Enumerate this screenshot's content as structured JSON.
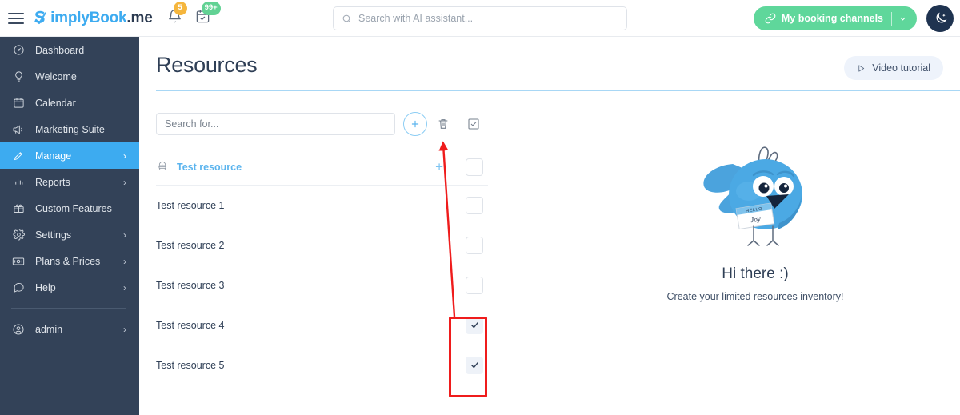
{
  "topbar": {
    "menu_icon": "hamburger-icon",
    "brand_part1": "S",
    "brand_part1b": "implyBook",
    "brand_part2": ".me",
    "notifications_badge": "5",
    "bookings_badge": "99+",
    "search_placeholder": "Search with AI assistant...",
    "search_value": "",
    "booking_channels_label": "My booking channels",
    "dark_mode_icon": "moon-icon"
  },
  "sidebar": {
    "items": [
      {
        "label": "Dashboard",
        "icon": "gauge-icon",
        "active": false,
        "chevron": false
      },
      {
        "label": "Welcome",
        "icon": "bulb-icon",
        "active": false,
        "chevron": false
      },
      {
        "label": "Calendar",
        "icon": "calendar-icon",
        "active": false,
        "chevron": false
      },
      {
        "label": "Marketing Suite",
        "icon": "megaphone-icon",
        "active": false,
        "chevron": false
      },
      {
        "label": "Manage",
        "icon": "pencil-icon",
        "active": true,
        "chevron": true
      },
      {
        "label": "Reports",
        "icon": "bar-chart-icon",
        "active": false,
        "chevron": true
      },
      {
        "label": "Custom Features",
        "icon": "gift-icon",
        "active": false,
        "chevron": false
      },
      {
        "label": "Settings",
        "icon": "gear-icon",
        "active": false,
        "chevron": true
      },
      {
        "label": "Plans & Prices",
        "icon": "money-icon",
        "active": false,
        "chevron": true
      },
      {
        "label": "Help",
        "icon": "chat-icon",
        "active": false,
        "chevron": true
      }
    ],
    "account": {
      "label": "admin",
      "icon": "user-circle-icon",
      "chevron": true
    }
  },
  "main": {
    "page_title": "Resources",
    "video_tutorial_label": "Video tutorial",
    "toolbar": {
      "search_placeholder": "Search for...",
      "search_value": "",
      "add_icon": "plus-icon",
      "delete_icon": "trash-icon",
      "select_all_icon": "checkbox-checked-icon"
    },
    "resources": [
      {
        "name": "Test resource",
        "parent": true,
        "icon": "chair-icon",
        "checked": false,
        "add_child": "+"
      },
      {
        "name": "Test resource 1",
        "parent": false,
        "checked": false
      },
      {
        "name": "Test resource 2",
        "parent": false,
        "checked": false
      },
      {
        "name": "Test resource 3",
        "parent": false,
        "checked": false
      },
      {
        "name": "Test resource 4",
        "parent": false,
        "checked": true
      },
      {
        "name": "Test resource 5",
        "parent": false,
        "checked": true
      }
    ],
    "empty_state": {
      "illustration": "blue-bird-mascot",
      "name_tag_hello": "HELLO",
      "name_tag_name": "Joy",
      "title": "Hi there :)",
      "subtitle": "Create your limited resources inventory!"
    }
  },
  "annotations": {
    "arrow_color": "#ef1c1c",
    "box_color": "#ef1c1c",
    "arrow_from": "checked-checkboxes",
    "arrow_to": "delete-icon"
  },
  "colors": {
    "sidebar_bg": "#334258",
    "sidebar_active": "#3dabf0",
    "brand_blue": "#3dabf0",
    "green_button": "#5fd79b",
    "text_dark": "#2f3f56",
    "annotation_red": "#ef1c1c"
  }
}
